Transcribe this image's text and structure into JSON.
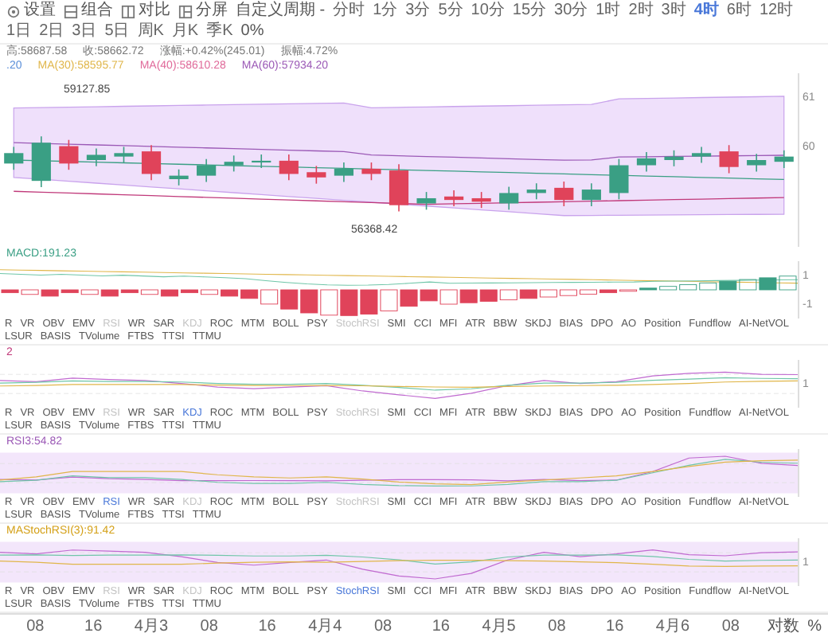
{
  "toolbar": {
    "tools": [
      "设置",
      "组合",
      "对比",
      "分屏"
    ],
    "custom_period": "自定义周期 -",
    "periods": [
      {
        "label": "分时",
        "selected": false
      },
      {
        "label": "1分",
        "selected": false
      },
      {
        "label": "3分",
        "selected": false
      },
      {
        "label": "5分",
        "selected": false
      },
      {
        "label": "10分",
        "selected": false
      },
      {
        "label": "15分",
        "selected": false
      },
      {
        "label": "30分",
        "selected": false
      },
      {
        "label": "1时",
        "selected": false
      },
      {
        "label": "2时",
        "selected": false
      },
      {
        "label": "3时",
        "selected": false
      },
      {
        "label": "4时",
        "selected": true
      },
      {
        "label": "6时",
        "selected": false
      },
      {
        "label": "12时",
        "selected": false
      },
      {
        "label": "1日",
        "selected": false
      },
      {
        "label": "2日",
        "selected": false
      },
      {
        "label": "3日",
        "selected": false
      },
      {
        "label": "5日",
        "selected": false
      },
      {
        "label": "周K",
        "selected": false
      },
      {
        "label": "月K",
        "selected": false
      },
      {
        "label": "季K",
        "selected": false
      }
    ],
    "zoom": "0%"
  },
  "quote": [
    "高:58687.58",
    "收:58662.72",
    "涨幅:+0.42%(245.01)",
    "振幅:4.72%"
  ],
  "moving_averages": [
    {
      "label": ".20",
      "color": "#5b8fd9"
    },
    {
      "label": "MA(30):58595.77",
      "color": "#e0b64a"
    },
    {
      "label": "MA(40):58610.28",
      "color": "#e06a9a"
    },
    {
      "label": "MA(60):57934.20",
      "color": "#9b59b6"
    }
  ],
  "main_chart": {
    "high_marker": "59127.85",
    "low_marker": "56368.42",
    "axis": [
      "61",
      "60"
    ]
  },
  "panels": [
    {
      "kind": "histogram",
      "label": "MACD:191.23",
      "axis": [
        "1",
        "-1"
      ],
      "tabs": [
        {
          "label": "R",
          "selected": false,
          "dimmed": false
        },
        {
          "label": "VR",
          "selected": false,
          "dimmed": false
        },
        {
          "label": "OBV",
          "selected": false,
          "dimmed": false
        },
        {
          "label": "EMV",
          "selected": false,
          "dimmed": false
        },
        {
          "label": "RSI",
          "selected": false,
          "dimmed": true
        },
        {
          "label": "WR",
          "selected": false,
          "dimmed": false
        },
        {
          "label": "SAR",
          "selected": false,
          "dimmed": false
        },
        {
          "label": "KDJ",
          "selected": false,
          "dimmed": true
        },
        {
          "label": "ROC",
          "selected": false,
          "dimmed": false
        },
        {
          "label": "MTM",
          "selected": false,
          "dimmed": false
        },
        {
          "label": "BOLL",
          "selected": false,
          "dimmed": false
        },
        {
          "label": "PSY",
          "selected": false,
          "dimmed": false
        },
        {
          "label": "StochRSI",
          "selected": false,
          "dimmed": true
        },
        {
          "label": "SMI",
          "selected": false,
          "dimmed": false
        },
        {
          "label": "CCI",
          "selected": false,
          "dimmed": false
        },
        {
          "label": "MFI",
          "selected": false,
          "dimmed": false
        },
        {
          "label": "ATR",
          "selected": false,
          "dimmed": false
        },
        {
          "label": "BBW",
          "selected": false,
          "dimmed": false
        },
        {
          "label": "SKDJ",
          "selected": false,
          "dimmed": false
        },
        {
          "label": "BIAS",
          "selected": false,
          "dimmed": false
        },
        {
          "label": "DPO",
          "selected": false,
          "dimmed": false
        },
        {
          "label": "AO",
          "selected": false,
          "dimmed": false
        },
        {
          "label": "Position",
          "selected": false,
          "dimmed": false
        },
        {
          "label": "Fundflow",
          "selected": false,
          "dimmed": false
        },
        {
          "label": "AI-NetVOL",
          "selected": false,
          "dimmed": false
        },
        {
          "label": "LSUR",
          "selected": false,
          "dimmed": false
        },
        {
          "label": "BASIS",
          "selected": false,
          "dimmed": false
        },
        {
          "label": "TVolume",
          "selected": false,
          "dimmed": false
        },
        {
          "label": "FTBS",
          "selected": false,
          "dimmed": false
        },
        {
          "label": "TTSI",
          "selected": false,
          "dimmed": false
        },
        {
          "label": "TTMU",
          "selected": false,
          "dimmed": false
        }
      ]
    },
    {
      "kind": "lines",
      "label": "2",
      "axis": [
        "1"
      ],
      "tabs": [
        {
          "label": "R",
          "selected": false,
          "dimmed": false
        },
        {
          "label": "VR",
          "selected": false,
          "dimmed": false
        },
        {
          "label": "OBV",
          "selected": false,
          "dimmed": false
        },
        {
          "label": "EMV",
          "selected": false,
          "dimmed": false
        },
        {
          "label": "RSI",
          "selected": false,
          "dimmed": true
        },
        {
          "label": "WR",
          "selected": false,
          "dimmed": false
        },
        {
          "label": "SAR",
          "selected": false,
          "dimmed": false
        },
        {
          "label": "KDJ",
          "selected": true,
          "dimmed": false
        },
        {
          "label": "ROC",
          "selected": false,
          "dimmed": false
        },
        {
          "label": "MTM",
          "selected": false,
          "dimmed": false
        },
        {
          "label": "BOLL",
          "selected": false,
          "dimmed": false
        },
        {
          "label": "PSY",
          "selected": false,
          "dimmed": false
        },
        {
          "label": "StochRSI",
          "selected": false,
          "dimmed": true
        },
        {
          "label": "SMI",
          "selected": false,
          "dimmed": false
        },
        {
          "label": "CCI",
          "selected": false,
          "dimmed": false
        },
        {
          "label": "MFI",
          "selected": false,
          "dimmed": false
        },
        {
          "label": "ATR",
          "selected": false,
          "dimmed": false
        },
        {
          "label": "BBW",
          "selected": false,
          "dimmed": false
        },
        {
          "label": "SKDJ",
          "selected": false,
          "dimmed": false
        },
        {
          "label": "BIAS",
          "selected": false,
          "dimmed": false
        },
        {
          "label": "DPO",
          "selected": false,
          "dimmed": false
        },
        {
          "label": "AO",
          "selected": false,
          "dimmed": false
        },
        {
          "label": "Position",
          "selected": false,
          "dimmed": false
        },
        {
          "label": "Fundflow",
          "selected": false,
          "dimmed": false
        },
        {
          "label": "AI-NetVOL",
          "selected": false,
          "dimmed": false
        },
        {
          "label": "LSUR",
          "selected": false,
          "dimmed": false
        },
        {
          "label": "BASIS",
          "selected": false,
          "dimmed": false
        },
        {
          "label": "TVolume",
          "selected": false,
          "dimmed": false
        },
        {
          "label": "FTBS",
          "selected": false,
          "dimmed": false
        },
        {
          "label": "TTSI",
          "selected": false,
          "dimmed": false
        },
        {
          "label": "TTMU",
          "selected": false,
          "dimmed": false
        }
      ]
    },
    {
      "kind": "band",
      "label": "RSI3:54.82",
      "tabs": [
        {
          "label": "R",
          "selected": false,
          "dimmed": false
        },
        {
          "label": "VR",
          "selected": false,
          "dimmed": false
        },
        {
          "label": "OBV",
          "selected": false,
          "dimmed": false
        },
        {
          "label": "EMV",
          "selected": false,
          "dimmed": false
        },
        {
          "label": "RSI",
          "selected": true,
          "dimmed": false
        },
        {
          "label": "WR",
          "selected": false,
          "dimmed": false
        },
        {
          "label": "SAR",
          "selected": false,
          "dimmed": false
        },
        {
          "label": "KDJ",
          "selected": false,
          "dimmed": true
        },
        {
          "label": "ROC",
          "selected": false,
          "dimmed": false
        },
        {
          "label": "MTM",
          "selected": false,
          "dimmed": false
        },
        {
          "label": "BOLL",
          "selected": false,
          "dimmed": false
        },
        {
          "label": "PSY",
          "selected": false,
          "dimmed": false
        },
        {
          "label": "StochRSI",
          "selected": false,
          "dimmed": true
        },
        {
          "label": "SMI",
          "selected": false,
          "dimmed": false
        },
        {
          "label": "CCI",
          "selected": false,
          "dimmed": false
        },
        {
          "label": "MFI",
          "selected": false,
          "dimmed": false
        },
        {
          "label": "ATR",
          "selected": false,
          "dimmed": false
        },
        {
          "label": "BBW",
          "selected": false,
          "dimmed": false
        },
        {
          "label": "SKDJ",
          "selected": false,
          "dimmed": false
        },
        {
          "label": "BIAS",
          "selected": false,
          "dimmed": false
        },
        {
          "label": "DPO",
          "selected": false,
          "dimmed": false
        },
        {
          "label": "AO",
          "selected": false,
          "dimmed": false
        },
        {
          "label": "Position",
          "selected": false,
          "dimmed": false
        },
        {
          "label": "Fundflow",
          "selected": false,
          "dimmed": false
        },
        {
          "label": "AI-NetVOL",
          "selected": false,
          "dimmed": false
        },
        {
          "label": "LSUR",
          "selected": false,
          "dimmed": false
        },
        {
          "label": "BASIS",
          "selected": false,
          "dimmed": false
        },
        {
          "label": "TVolume",
          "selected": false,
          "dimmed": false
        },
        {
          "label": "FTBS",
          "selected": false,
          "dimmed": false
        },
        {
          "label": "TTSI",
          "selected": false,
          "dimmed": false
        },
        {
          "label": "TTMU",
          "selected": false,
          "dimmed": false
        }
      ]
    },
    {
      "kind": "band",
      "label": "MAStochRSI(3):91.42",
      "axis": [
        "1"
      ],
      "tabs": [
        {
          "label": "R",
          "selected": false,
          "dimmed": false
        },
        {
          "label": "VR",
          "selected": false,
          "dimmed": false
        },
        {
          "label": "OBV",
          "selected": false,
          "dimmed": false
        },
        {
          "label": "EMV",
          "selected": false,
          "dimmed": false
        },
        {
          "label": "RSI",
          "selected": false,
          "dimmed": true
        },
        {
          "label": "WR",
          "selected": false,
          "dimmed": false
        },
        {
          "label": "SAR",
          "selected": false,
          "dimmed": false
        },
        {
          "label": "KDJ",
          "selected": false,
          "dimmed": true
        },
        {
          "label": "ROC",
          "selected": false,
          "dimmed": false
        },
        {
          "label": "MTM",
          "selected": false,
          "dimmed": false
        },
        {
          "label": "BOLL",
          "selected": false,
          "dimmed": false
        },
        {
          "label": "PSY",
          "selected": false,
          "dimmed": false
        },
        {
          "label": "StochRSI",
          "selected": true,
          "dimmed": false
        },
        {
          "label": "SMI",
          "selected": false,
          "dimmed": false
        },
        {
          "label": "CCI",
          "selected": false,
          "dimmed": false
        },
        {
          "label": "MFI",
          "selected": false,
          "dimmed": false
        },
        {
          "label": "ATR",
          "selected": false,
          "dimmed": false
        },
        {
          "label": "BBW",
          "selected": false,
          "dimmed": false
        },
        {
          "label": "SKDJ",
          "selected": false,
          "dimmed": false
        },
        {
          "label": "BIAS",
          "selected": false,
          "dimmed": false
        },
        {
          "label": "DPO",
          "selected": false,
          "dimmed": false
        },
        {
          "label": "AO",
          "selected": false,
          "dimmed": false
        },
        {
          "label": "Position",
          "selected": false,
          "dimmed": false
        },
        {
          "label": "Fundflow",
          "selected": false,
          "dimmed": false
        },
        {
          "label": "AI-NetVOL",
          "selected": false,
          "dimmed": false
        },
        {
          "label": "LSUR",
          "selected": false,
          "dimmed": false
        },
        {
          "label": "BASIS",
          "selected": false,
          "dimmed": false
        },
        {
          "label": "TVolume",
          "selected": false,
          "dimmed": false
        },
        {
          "label": "FTBS",
          "selected": false,
          "dimmed": false
        },
        {
          "label": "TTSI",
          "selected": false,
          "dimmed": false
        },
        {
          "label": "TTMU",
          "selected": false,
          "dimmed": false
        }
      ]
    }
  ],
  "time_axis": [
    "08",
    "16",
    "4月3",
    "08",
    "16",
    "4月4",
    "08",
    "16",
    "4月5",
    "08",
    "16",
    "4月6",
    "08"
  ],
  "scale_buttons": [
    "对数",
    "%"
  ]
}
